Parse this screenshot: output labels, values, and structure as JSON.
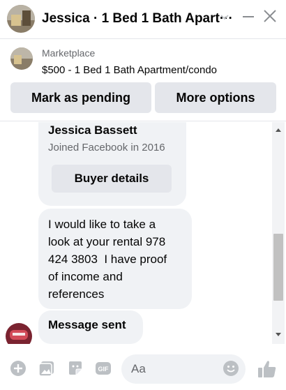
{
  "header": {
    "title": "Jessica · 1 Bed 1 Bath Apart···"
  },
  "listing": {
    "kind": "Marketplace",
    "item": "$500 - 1 Bed 1 Bath Apartment/condo",
    "mark_pending_label": "Mark as pending",
    "more_options_label": "More options"
  },
  "conversation": {
    "buyer_name": "Jessica Bassett",
    "joined": "Joined Facebook in 2016",
    "buyer_details_label": "Buyer details",
    "message_lines": [
      "I would like to take a",
      "look at your rental 978",
      "424 3803  I have proof",
      "of income and",
      "references"
    ],
    "sent_text": "Message sent"
  },
  "composer": {
    "placeholder": "Aa",
    "gif_label": "GIF"
  },
  "colors": {
    "accent": "#0084ff",
    "icon_gray": "#bcc0c4",
    "bubble": "#f0f2f5",
    "button": "#e4e6eb"
  }
}
